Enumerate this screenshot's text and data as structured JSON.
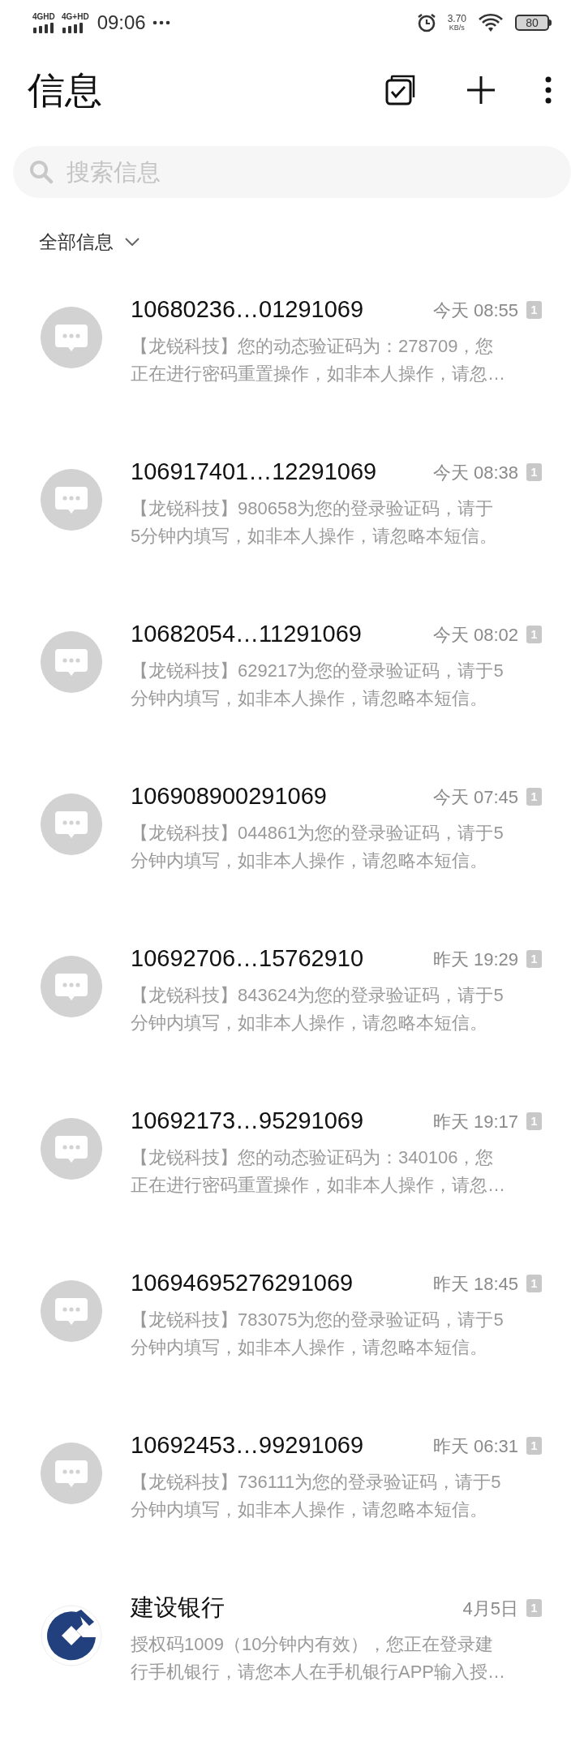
{
  "status_bar": {
    "sim_labels": [
      "4GHD",
      "4G+HD"
    ],
    "time": "09:06",
    "speed_value": "3.70",
    "speed_unit": "KB/s",
    "battery": "80"
  },
  "header": {
    "title": "信息"
  },
  "search": {
    "placeholder": "搜索信息"
  },
  "filter": {
    "label": "全部信息"
  },
  "conversations": [
    {
      "kind": "generic",
      "sender": "10680236…01291069",
      "time": "今天 08:55",
      "sim": "1",
      "preview": [
        "【龙锐科技】您的动态验证码为：278709，您",
        "正在进行密码重置操作，如非本人操作，请忽…"
      ]
    },
    {
      "kind": "generic",
      "sender": "106917401…12291069",
      "time": "今天 08:38",
      "sim": "1",
      "preview": [
        "【龙锐科技】980658为您的登录验证码，请于",
        "5分钟内填写，如非本人操作，请忽略本短信。"
      ]
    },
    {
      "kind": "generic",
      "sender": "10682054…11291069",
      "time": "今天 08:02",
      "sim": "1",
      "preview": [
        "【龙锐科技】629217为您的登录验证码，请于5",
        "分钟内填写，如非本人操作，请忽略本短信。"
      ]
    },
    {
      "kind": "generic",
      "sender": "106908900291069",
      "time": "今天 07:45",
      "sim": "1",
      "preview": [
        "【龙锐科技】044861为您的登录验证码，请于5",
        "分钟内填写，如非本人操作，请忽略本短信。"
      ]
    },
    {
      "kind": "generic",
      "sender": "10692706…15762910",
      "time": "昨天 19:29",
      "sim": "1",
      "preview": [
        "【龙锐科技】843624为您的登录验证码，请于5",
        "分钟内填写，如非本人操作，请忽略本短信。"
      ]
    },
    {
      "kind": "generic",
      "sender": "10692173…95291069",
      "time": "昨天 19:17",
      "sim": "1",
      "preview": [
        "【龙锐科技】您的动态验证码为：340106，您",
        "正在进行密码重置操作，如非本人操作，请忽…"
      ]
    },
    {
      "kind": "generic",
      "sender": "10694695276291069",
      "time": "昨天 18:45",
      "sim": "1",
      "preview": [
        "【龙锐科技】783075为您的登录验证码，请于5",
        "分钟内填写，如非本人操作，请忽略本短信。"
      ]
    },
    {
      "kind": "generic",
      "sender": "10692453…99291069",
      "time": "昨天 06:31",
      "sim": "1",
      "preview": [
        "【龙锐科技】736111为您的登录验证码，请于5",
        "分钟内填写，如非本人操作，请忽略本短信。"
      ]
    },
    {
      "kind": "bank",
      "sender": "建设银行",
      "time": "4月5日",
      "sim": "1",
      "preview": [
        "授权码1009（10分钟内有效），您正在登录建",
        "行手机银行，请您本人在手机银行APP输入授…"
      ]
    }
  ]
}
